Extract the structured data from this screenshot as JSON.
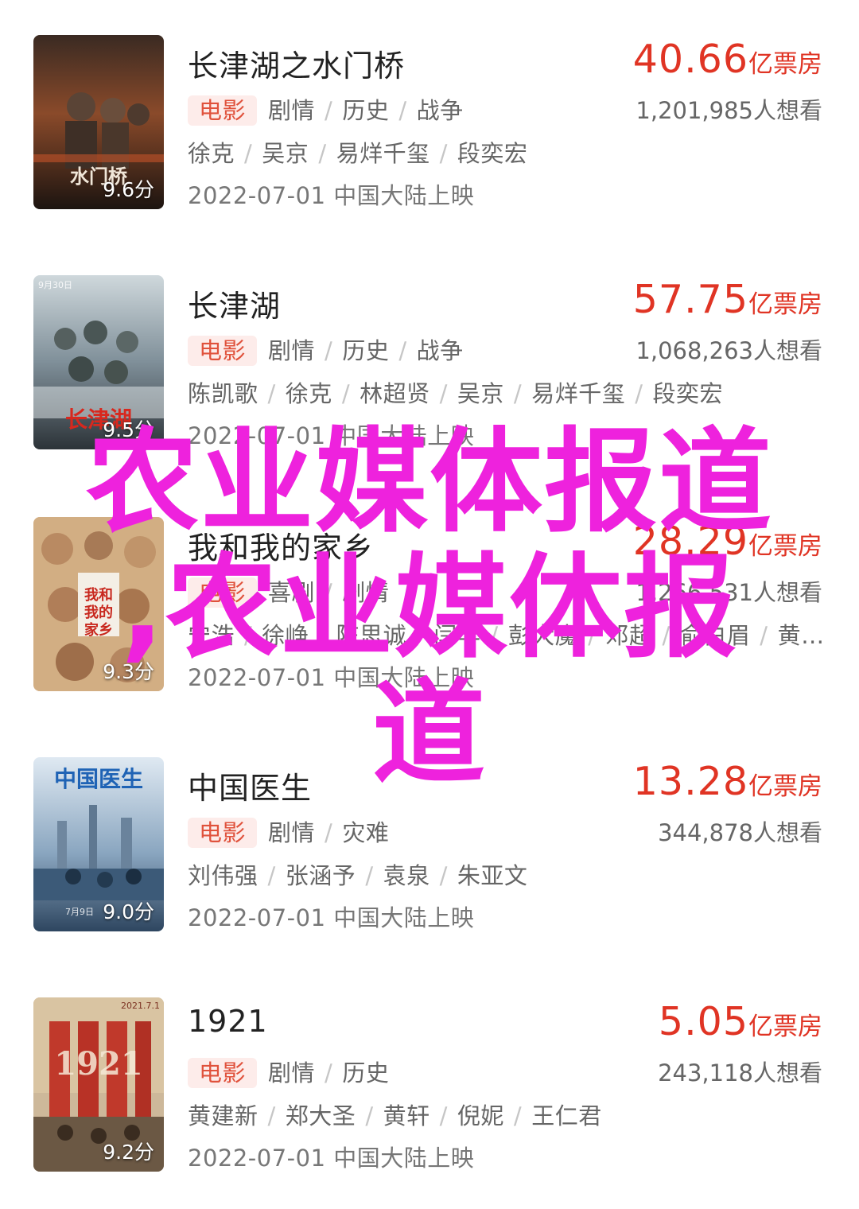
{
  "movies": [
    {
      "title": "长津湖之水门桥",
      "type_badge": "电影",
      "genres": [
        "剧情",
        "历史",
        "战争"
      ],
      "cast": [
        "徐克",
        "吴京",
        "易烊千玺",
        "段奕宏"
      ],
      "release": "2022-07-01 中国大陆上映",
      "box_office": "40.66",
      "box_unit": "亿票房",
      "want": "1,201,985人想看",
      "score": "9.6分",
      "poster_text": "水门桥",
      "poster_small": ""
    },
    {
      "title": "长津湖",
      "type_badge": "电影",
      "genres": [
        "剧情",
        "历史",
        "战争"
      ],
      "cast": [
        "陈凯歌",
        "徐克",
        "林超贤",
        "吴京",
        "易烊千玺",
        "段奕宏"
      ],
      "release": "2022-07-01 中国大陆上映",
      "box_office": "57.75",
      "box_unit": "亿票房",
      "want": "1,068,263人想看",
      "score": "9.5分",
      "poster_text": "长津湖",
      "poster_small": "9月30日"
    },
    {
      "title": "我和我的家乡",
      "type_badge": "电影",
      "genres": [
        "喜剧",
        "剧情"
      ],
      "cast": [
        "宁浩",
        "徐峥",
        "陈思诚",
        "闫非",
        "彭大魔",
        "邓超",
        "俞白眉",
        "黄…"
      ],
      "release": "2022-07-01 中国大陆上映",
      "box_office": "28.29",
      "box_unit": "亿票房",
      "want": "1,266,531人想看",
      "score": "9.3分",
      "poster_text": "我和我的家乡",
      "poster_small": ""
    },
    {
      "title": "中国医生",
      "type_badge": "电影",
      "genres": [
        "剧情",
        "灾难"
      ],
      "cast": [
        "刘伟强",
        "张涵予",
        "袁泉",
        "朱亚文"
      ],
      "release": "2022-07-01 中国大陆上映",
      "box_office": "13.28",
      "box_unit": "亿票房",
      "want": "344,878人想看",
      "score": "9.0分",
      "poster_text": "中国医生",
      "poster_small": "7月9日"
    },
    {
      "title": "1921",
      "type_badge": "电影",
      "genres": [
        "剧情",
        "历史"
      ],
      "cast": [
        "黄建新",
        "郑大圣",
        "黄轩",
        "倪妮",
        "王仁君"
      ],
      "release": "2022-07-01 中国大陆上映",
      "box_office": "5.05",
      "box_unit": "亿票房",
      "want": "243,118人想看",
      "score": "9.2分",
      "poster_text": "1921",
      "poster_small": "2021.7.1"
    }
  ],
  "overlay": {
    "line1": "农业媒体报道",
    "line2": ",农业媒体报",
    "line3": "道"
  },
  "colors": {
    "accent": "#e03424",
    "badge_bg": "#fdecea",
    "overlay": "#ee22dd"
  }
}
